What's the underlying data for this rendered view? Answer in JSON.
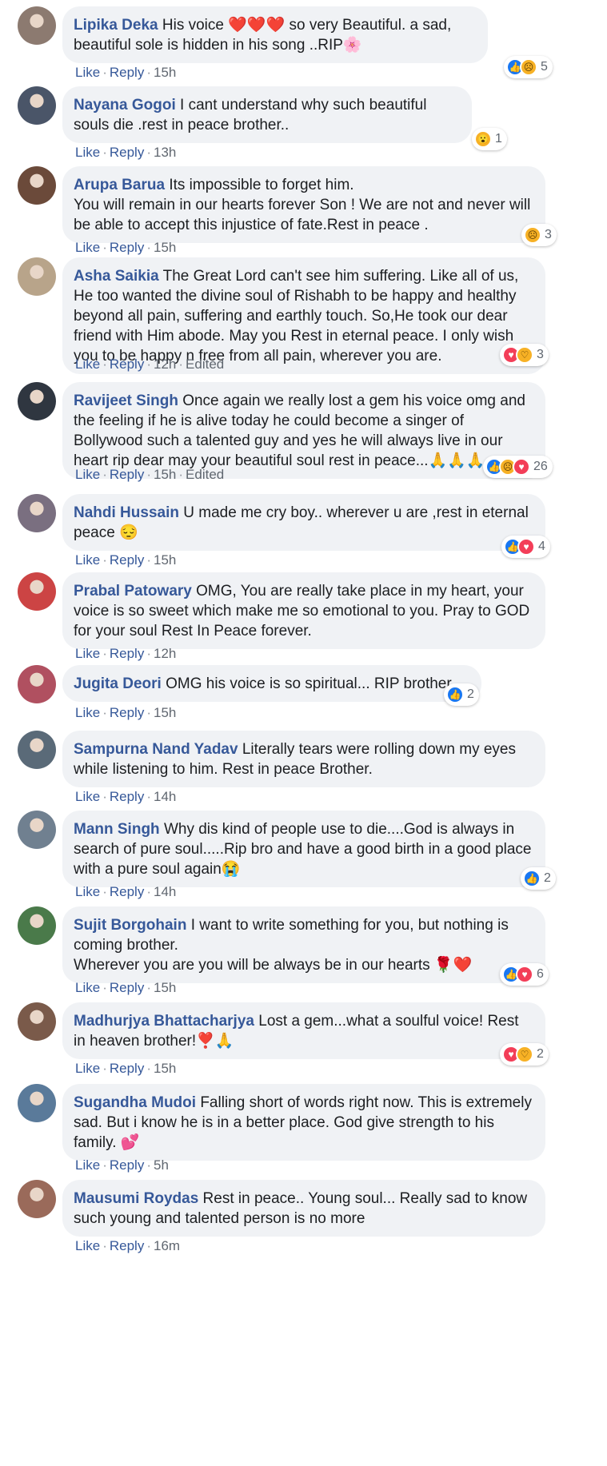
{
  "colors": {
    "author": "#365899",
    "bubble": "#f0f2f5",
    "meta": "#606770",
    "like": "#1877f2",
    "love": "#f33e58",
    "emoji_face": "#f7b125"
  },
  "actions": {
    "like": "Like",
    "reply": "Reply",
    "separator": "·"
  },
  "comments": [
    {
      "author": "Lipika Deka",
      "text": "His voice ❤️❤️❤️ so very Beautiful. a sad, beautiful sole is hidden in his song ..RIP🌸",
      "time": "15h",
      "edited": "",
      "reactions": [
        "like-icon",
        "sad-icon"
      ],
      "reaction_count": "5"
    },
    {
      "author": "Nayana Gogoi",
      "text": "I cant understand why such beautiful souls die .rest in peace brother..",
      "time": "13h",
      "edited": "",
      "reactions": [
        "wow-icon"
      ],
      "reaction_count": "1"
    },
    {
      "author": "Arupa Barua",
      "text": "Its impossible to forget him.\nYou will remain in our hearts forever Son ! We are not and never will be able to accept this injustice of fate.Rest in peace .",
      "time": "15h",
      "edited": "",
      "reactions": [
        "sad-icon"
      ],
      "reaction_count": "3"
    },
    {
      "author": "Asha Saikia",
      "text": "The Great Lord can't see him suffering. Like all of us, He too wanted the divine soul of Rishabh to be happy and healthy beyond all pain, suffering and earthly touch. So,He took our dear friend with Him abode. May you Rest in eternal peace. I only wish you to be happy n free from all pain, wherever you are.",
      "time": "12h",
      "edited": "Edited",
      "reactions": [
        "love-icon",
        "care-icon"
      ],
      "reaction_count": "3"
    },
    {
      "author": "Ravijeet Singh",
      "text": "Once again we really lost a gem his voice omg and the feeling if he is alive today he could become a singer of Bollywood such a talented guy and yes he will always live in our heart rip dear may your beautiful soul rest in peace...🙏🙏🙏",
      "time": "15h",
      "edited": "Edited",
      "reactions": [
        "like-icon",
        "sad-icon",
        "love-icon"
      ],
      "reaction_count": "26"
    },
    {
      "author": "Nahdi Hussain",
      "text": "U made me cry boy.. wherever u are ,rest in eternal peace 😔",
      "time": "15h",
      "edited": "",
      "reactions": [
        "like-icon",
        "love-icon"
      ],
      "reaction_count": "4"
    },
    {
      "author": "Prabal Patowary",
      "text": "OMG, You are really take place in my heart, your voice is so sweet which make me so emotional to you. Pray to GOD for your soul Rest In Peace forever.",
      "time": "12h",
      "edited": "",
      "reactions": [],
      "reaction_count": ""
    },
    {
      "author": "Jugita Deori",
      "text": "OMG his voice is so spiritual... RIP brother...",
      "time": "15h",
      "edited": "",
      "reactions": [
        "like-icon"
      ],
      "reaction_count": "2"
    },
    {
      "author": "Sampurna Nand Yadav",
      "text": "Literally tears were rolling down my eyes while listening to him. Rest in peace Brother.",
      "time": "14h",
      "edited": "",
      "reactions": [],
      "reaction_count": ""
    },
    {
      "author": "Mann Singh",
      "text": "Why dis kind of people use to die....God is always in search of pure soul.....Rip bro and have a good birth in a good place with a pure soul again😭",
      "time": "14h",
      "edited": "",
      "reactions": [
        "like-icon"
      ],
      "reaction_count": "2"
    },
    {
      "author": "Sujit Borgohain",
      "text": "I want to write something for you, but nothing is coming brother.\nWherever you are you will be always be in our hearts 🌹❤️",
      "time": "15h",
      "edited": "",
      "reactions": [
        "like-icon",
        "love-icon"
      ],
      "reaction_count": "6"
    },
    {
      "author": "Madhurjya Bhattacharjya",
      "text": "Lost a gem...what a soulful voice! Rest in heaven brother!❣️🙏",
      "time": "15h",
      "edited": "",
      "reactions": [
        "love-icon",
        "care-icon"
      ],
      "reaction_count": "2"
    },
    {
      "author": "Sugandha Mudoi",
      "text": "Falling short of words right now. This is extremely sad. But i know he is in a better place. God give strength to his family. 💕",
      "time": "5h",
      "edited": "",
      "reactions": [],
      "reaction_count": ""
    },
    {
      "author": "Mausumi Roydas",
      "text": "Rest in peace.. Young soul... Really sad to know such young and talented person is no more",
      "time": "16m",
      "edited": "",
      "reactions": [],
      "reaction_count": ""
    }
  ]
}
